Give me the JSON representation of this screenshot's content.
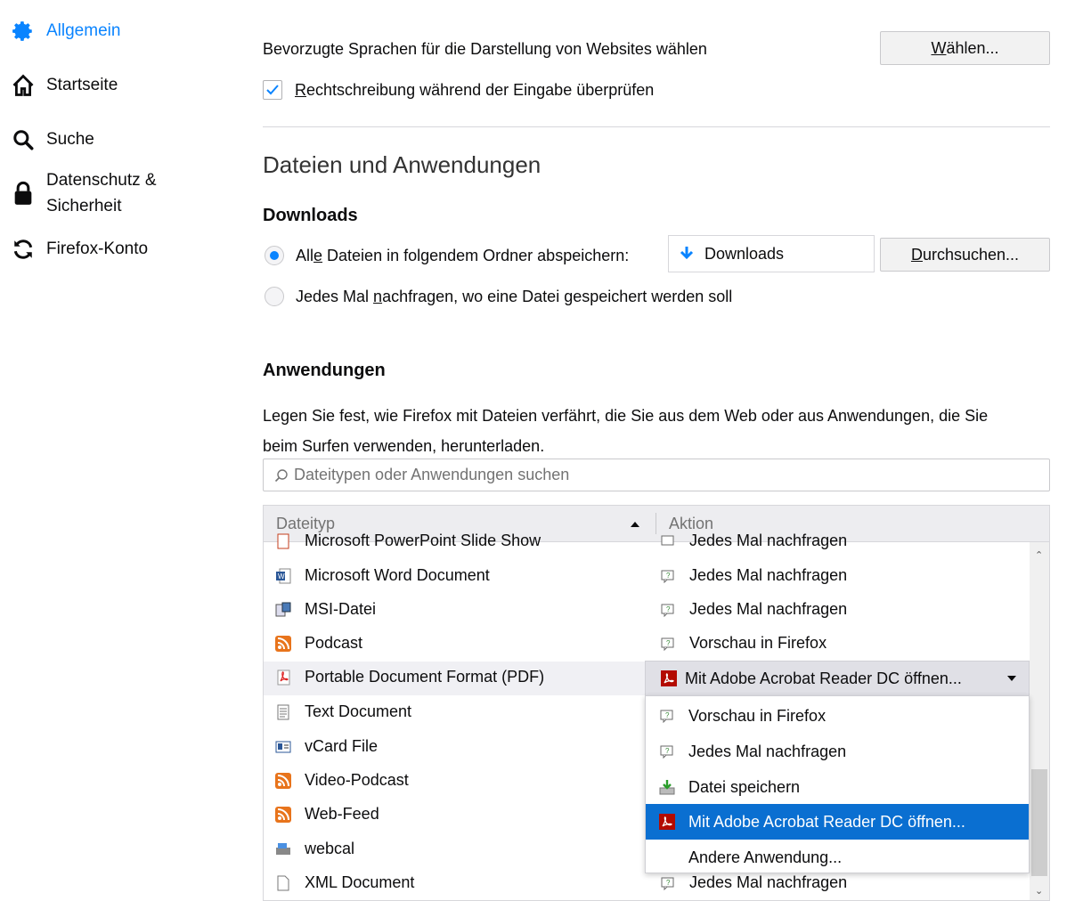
{
  "sidebar": {
    "items": [
      {
        "label": "Allgemein",
        "icon": "gear-icon",
        "active": true
      },
      {
        "label": "Startseite",
        "icon": "home-icon"
      },
      {
        "label": "Suche",
        "icon": "search-icon"
      },
      {
        "label_line1": "Datenschutz &",
        "label_line2": "Sicherheit",
        "icon": "lock-icon"
      },
      {
        "label": "Firefox-Konto",
        "icon": "sync-icon"
      }
    ]
  },
  "language": {
    "text": "Bevorzugte Sprachen für die Darstellung von Websites wählen",
    "choose_button_prefix": "",
    "choose_button_access": "W",
    "choose_button_rest": "ählen...",
    "spellcheck_access": "R",
    "spellcheck_rest": "echtschreibung während der Eingabe überprüfen",
    "spellcheck_checked": true
  },
  "files_section": {
    "title": "Dateien und Anwendungen",
    "downloads_heading": "Downloads",
    "save_all_pre": "All",
    "save_all_access": "e",
    "save_all_post": " Dateien in folgendem Ordner abspeichern:",
    "folder_name": "Downloads",
    "browse_access": "D",
    "browse_rest": "urchsuchen...",
    "ask_pre": "Jedes Mal ",
    "ask_access": "n",
    "ask_post": "achfragen, wo eine Datei gespeichert werden soll"
  },
  "applications": {
    "heading": "Anwendungen",
    "desc_line1": "Legen Sie fest, wie Firefox mit Dateien verfährt, die Sie aus dem Web oder aus Anwendungen, die Sie",
    "desc_line2": "beim Surfen verwenden, herunterladen.",
    "search_placeholder": "Dateitypen oder Anwendungen suchen",
    "col_type": "Dateityp",
    "col_action": "Aktion",
    "rows": [
      {
        "type": "Microsoft PowerPoint Slide Show",
        "action": "Jedes Mal nachfragen"
      },
      {
        "type": "Microsoft Word Document",
        "action": "Jedes Mal nachfragen"
      },
      {
        "type": "MSI-Datei",
        "action": "Jedes Mal nachfragen"
      },
      {
        "type": "Podcast",
        "action": "Vorschau in Firefox"
      },
      {
        "type": "Portable Document Format (PDF)",
        "action": "Mit Adobe Acrobat Reader DC  öffnen..."
      },
      {
        "type": "Text Document",
        "action": ""
      },
      {
        "type": "vCard File",
        "action": ""
      },
      {
        "type": "Video-Podcast",
        "action": ""
      },
      {
        "type": "Web-Feed",
        "action": ""
      },
      {
        "type": "webcal",
        "action": ""
      },
      {
        "type": "XML Document",
        "action": "Jedes Mal nachfragen"
      }
    ],
    "dropdown_options": [
      "Vorschau in Firefox",
      "Jedes Mal nachfragen",
      "Datei speichern",
      "Mit Adobe Acrobat Reader DC  öffnen...",
      "Andere Anwendung..."
    ]
  },
  "colors": {
    "accent": "#0a84ff",
    "selection": "#0a6fd1"
  }
}
